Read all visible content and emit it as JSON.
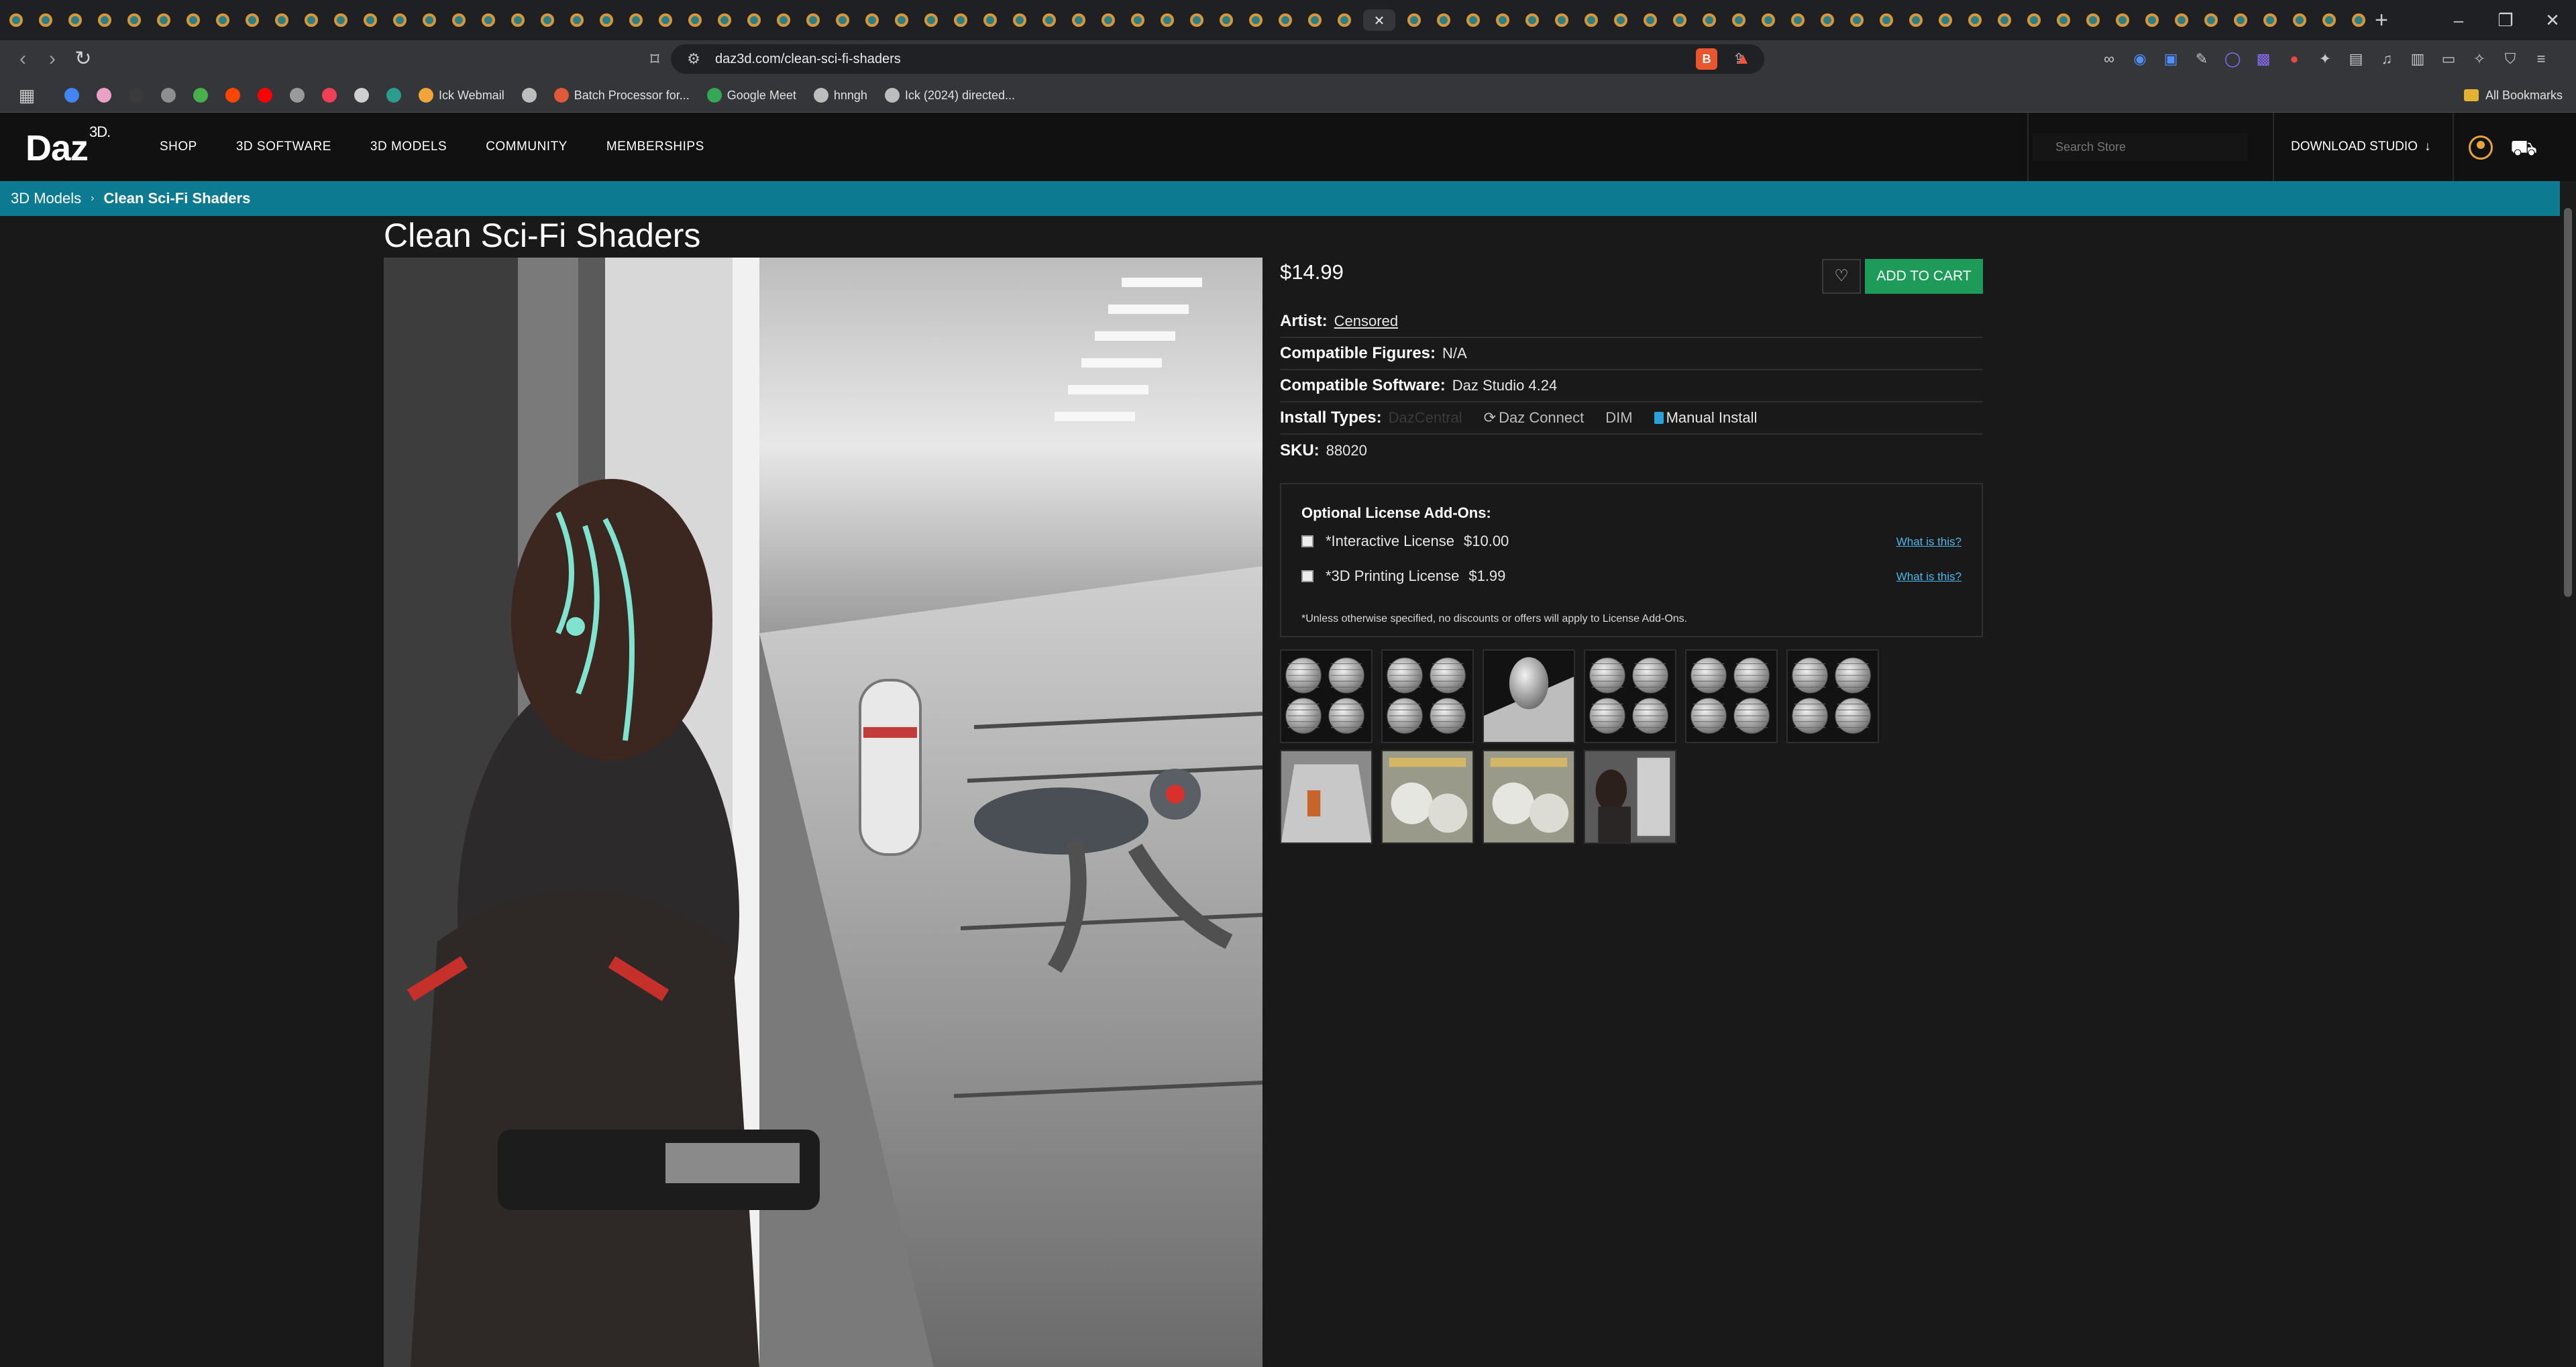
{
  "browser": {
    "active_tab_close": "×",
    "new_tab": "+",
    "window_controls": {
      "minimize": "–",
      "restore": "❐",
      "close": "✕"
    },
    "url": "daz3d.com/clean-sci-fi-shaders",
    "bookmarks": [
      {
        "label": "",
        "color": "#4285f4"
      },
      {
        "label": "",
        "color": "#e9a2c6"
      },
      {
        "label": "",
        "color": "#3a3a3a"
      },
      {
        "label": "",
        "color": "#8e8e8e"
      },
      {
        "label": "",
        "color": "#48b04d"
      },
      {
        "label": "",
        "color": "#ff4500"
      },
      {
        "label": "",
        "color": "#ff0000"
      },
      {
        "label": "",
        "color": "#9a9a9a"
      },
      {
        "label": "",
        "color": "#ef4056"
      },
      {
        "label": "",
        "color": "#cfcfcf"
      },
      {
        "label": "",
        "color": "#2a9d8f"
      },
      {
        "label": "Ick Webmail",
        "color": "#f2a33a"
      },
      {
        "label": "",
        "color": "#bdbdbd"
      },
      {
        "label": "Batch Processor for...",
        "color": "#e05a3a"
      },
      {
        "label": "Google Meet",
        "color": "#34a853"
      },
      {
        "label": "hnngh",
        "color": "#bdbdbd"
      },
      {
        "label": "Ick (2024) directed...",
        "color": "#bdbdbd"
      }
    ],
    "all_bookmarks": "All Bookmarks"
  },
  "site": {
    "logo": "Daz",
    "logo_sup": "3D.",
    "nav": [
      "SHOP",
      "3D SOFTWARE",
      "3D MODELS",
      "COMMUNITY",
      "MEMBERSHIPS"
    ],
    "search_placeholder": "Search Store",
    "download_studio": "DOWNLOAD STUDIO",
    "download_arrow": "↓"
  },
  "breadcrumb": {
    "parent": "3D Models",
    "separator": "›",
    "current": "Clean Sci-Fi Shaders"
  },
  "product": {
    "title": "Clean Sci-Fi Shaders",
    "price": "$14.99",
    "wishlist_icon": "♡",
    "add_to_cart": "ADD TO CART",
    "artist_label": "Artist:",
    "artist": "Censored",
    "figures_label": "Compatible Figures:",
    "figures": "N/A",
    "software_label": "Compatible Software:",
    "software": "Daz Studio 4.24",
    "install_label": "Install Types:",
    "install_types": [
      "DazCentral",
      "Daz Connect",
      "DIM",
      "Manual Install"
    ],
    "sku_label": "SKU:",
    "sku": "88020"
  },
  "license": {
    "title": "Optional License Add-Ons:",
    "options": [
      {
        "name": "*Interactive License",
        "price": "$10.00",
        "help": "What is this?"
      },
      {
        "name": "*3D Printing License",
        "price": "$1.99",
        "help": "What is this?"
      }
    ],
    "note": "*Unless otherwise specified, no discounts or offers will apply to License Add-Ons."
  },
  "colors": {
    "accent_teal": "#0c7a91",
    "cart_green": "#1e9b58",
    "link_blue": "#4fb6e8",
    "bg": "#191919"
  }
}
